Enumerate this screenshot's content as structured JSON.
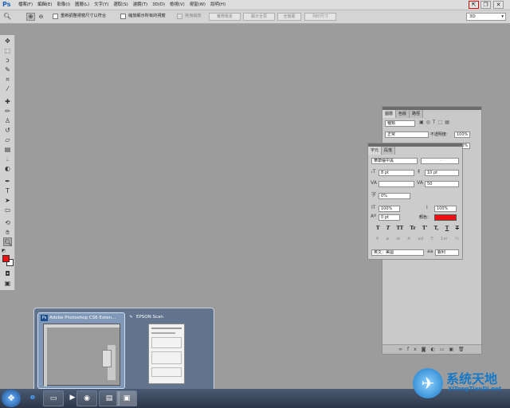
{
  "app": {
    "logo": "Ps"
  },
  "menu": [
    "檔案(F)",
    "編輯(E)",
    "影像(I)",
    "圖層(L)",
    "文字(Y)",
    "選取(S)",
    "濾鏡(T)",
    "3D(D)",
    "檢視(V)",
    "視窗(W)",
    "說明(H)"
  ],
  "window_controls": {
    "mode_icon": "⇱",
    "restore_icon": "❐",
    "close_icon": "✕"
  },
  "options_bar": {
    "resize_label": "重新調整視窗尺寸以符合",
    "zoom_all_label": "縮放顯示所有的視窗",
    "scrubby_label": "拖曳縮放",
    "actual_pixels": "實際像素",
    "fit_screen": "顯示全頁",
    "fill_screen": "全螢幕",
    "print_size": "列印尺寸",
    "workspace": "3D"
  },
  "layers_panel": {
    "tabs": [
      "圖層",
      "色版",
      "路徑"
    ],
    "kind_label": "種類",
    "blend_mode": "正常",
    "opacity_label": "不透明度:",
    "opacity_value": "100%",
    "fill_value": "100%"
  },
  "char_panel": {
    "tabs": [
      "字元",
      "段落"
    ],
    "font_family": "華康儷中黑",
    "font_style": "-",
    "font_size": "8 pt",
    "leading": "10 pt",
    "kerning": "",
    "tracking": "50",
    "scale_pct": "0%",
    "v_scale": "100%",
    "h_scale": "100%",
    "baseline": "0 pt",
    "color_label": "顏色：",
    "color_value": "#ee1111",
    "language": "英文：美國",
    "anti_alias_label": "aa",
    "anti_alias": "銳利",
    "style_buttons": [
      "T",
      "T",
      "TT",
      "Tr",
      "T'",
      "T,",
      "T",
      "T"
    ],
    "opentype_buttons": [
      "fi",
      "ø",
      "st",
      "A",
      "ad",
      "T",
      "1st",
      "½"
    ]
  },
  "taskbar_preview": {
    "items": [
      {
        "title": "Adobe Photoshop CS6 Exten...",
        "icon": "Ps"
      },
      {
        "title": "EPSON Scan",
        "icon": "✎"
      }
    ]
  },
  "taskbar": {
    "start_icon": "❖",
    "buttons": [
      "ie",
      "folder",
      "media",
      "chrome",
      "explorer",
      "photoshop"
    ]
  },
  "watermark": {
    "title": "系统天地",
    "url": "XiTongTianDi.net"
  }
}
